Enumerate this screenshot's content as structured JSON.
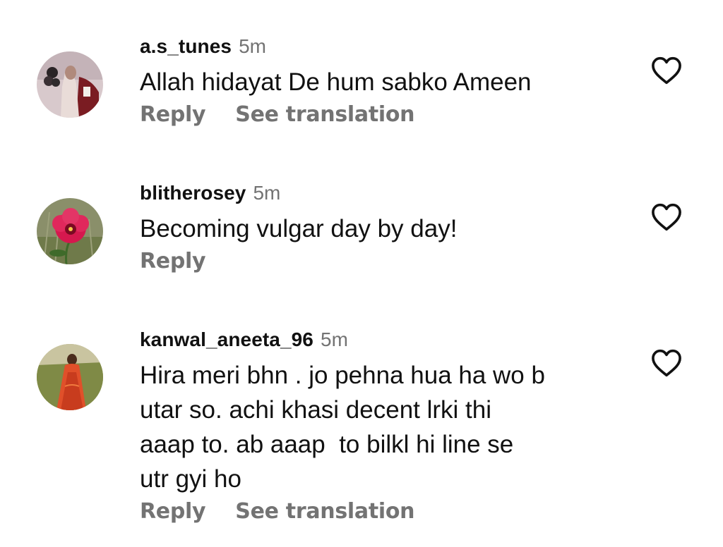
{
  "colors": {
    "text": "#111111",
    "secondary": "#737373",
    "background": "#ffffff"
  },
  "comments": [
    {
      "username": "a.s_tunes",
      "time": "5m",
      "text": "Allah hidayat De hum sabko Ameen",
      "actions": {
        "reply": "Reply",
        "translate": "See translation"
      },
      "like_icon": "heart-outline-icon"
    },
    {
      "username": "blitherosey",
      "time": "5m",
      "text": "Becoming vulgar day by day!",
      "actions": {
        "reply": "Reply"
      },
      "like_icon": "heart-outline-icon"
    },
    {
      "username": "kanwal_aneeta_96",
      "time": "5m",
      "text_lines": [
        "Hira meri bhn . jo pehna hua ha wo b",
        "utar so. achi khasi decent lrki thi",
        "aaap to. ab aaap  to bilkl hi line se",
        "utr gyi ho"
      ],
      "actions": {
        "reply": "Reply",
        "translate": "See translation"
      },
      "like_icon": "heart-outline-icon"
    }
  ]
}
